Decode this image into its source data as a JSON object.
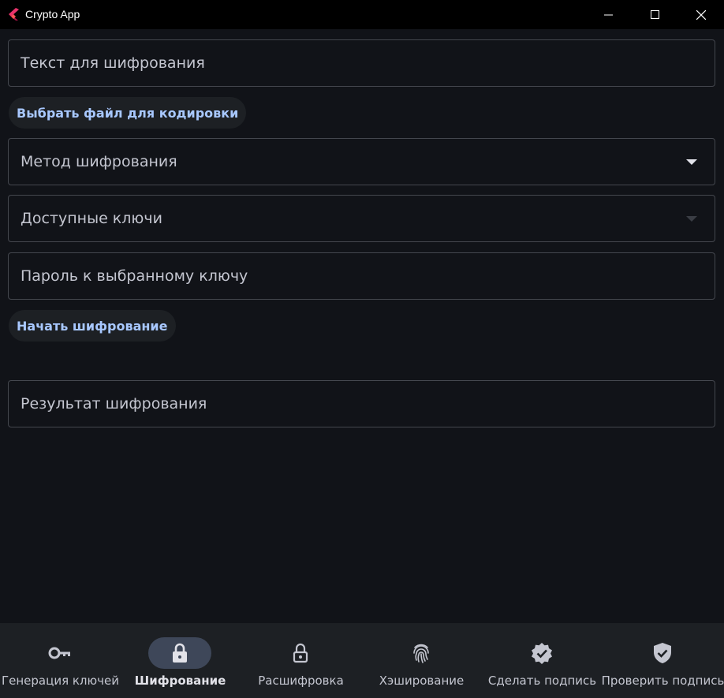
{
  "window": {
    "title": "Crypto App",
    "logo_icon": "flutter-logo-icon",
    "controls": [
      "minimize-icon",
      "maximize-icon",
      "close-icon"
    ]
  },
  "form": {
    "text_input": {
      "placeholder": "Текст для шифрования",
      "value": ""
    },
    "choose_file_button": "Выбрать файл для кодировки",
    "method_dropdown": {
      "label": "Метод шифрования",
      "enabled": true
    },
    "keys_dropdown": {
      "label": "Доступные ключи",
      "enabled": false
    },
    "password_input": {
      "placeholder": "Пароль к выбранному ключу",
      "value": ""
    },
    "start_button": "Начать шифрование",
    "result_input": {
      "placeholder": "Результат шифрования",
      "value": ""
    }
  },
  "nav": {
    "items": [
      {
        "label": "Генерация ключей",
        "icon": "key-icon",
        "active": false
      },
      {
        "label": "Шифрование",
        "icon": "lock-icon",
        "active": true
      },
      {
        "label": "Расшифровка",
        "icon": "lock-open-icon",
        "active": false
      },
      {
        "label": "Хэширование",
        "icon": "fingerprint-icon",
        "active": false
      },
      {
        "label": "Сделать подпись",
        "icon": "verified-badge-icon",
        "active": false
      },
      {
        "label": "Проверить подпись",
        "icon": "shield-check-icon",
        "active": false
      }
    ]
  },
  "colors": {
    "background": "#111318",
    "titlebar": "#000000",
    "navbar": "#1d2024",
    "accent": "#a8c8ff",
    "active_pill": "#3e4759",
    "outline": "#44474e"
  }
}
